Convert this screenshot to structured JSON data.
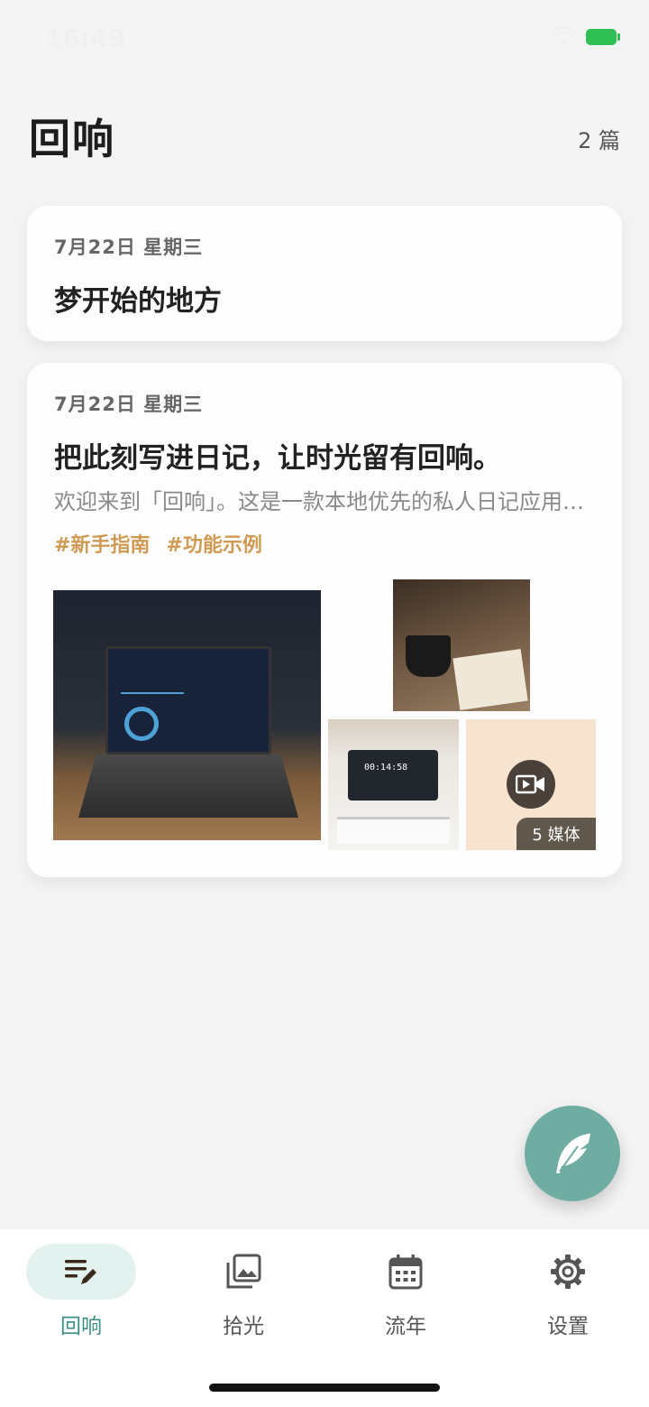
{
  "status_bar": {
    "time": "16:49"
  },
  "header": {
    "title": "回响",
    "count": "2 篇"
  },
  "entries": [
    {
      "date": "7月22日 星期三",
      "title": "梦开始的地方"
    },
    {
      "date": "7月22日 星期三",
      "title": "把此刻写进日记，让时光留有回响。",
      "excerpt": "欢迎来到「回响」。这是一款本地优先的私人日记应用…",
      "tags": [
        "#新手指南",
        "#功能示例"
      ],
      "media_badge": "5 媒体"
    }
  ],
  "tabbar": {
    "items": [
      {
        "label": "回响",
        "icon": "journal-edit-icon",
        "active": true
      },
      {
        "label": "拾光",
        "icon": "gallery-icon",
        "active": false
      },
      {
        "label": "流年",
        "icon": "calendar-icon",
        "active": false
      },
      {
        "label": "设置",
        "icon": "gear-icon",
        "active": false
      }
    ]
  },
  "colors": {
    "accent": "#3d8f86",
    "fab": "#6fada3",
    "tag": "#d09a52",
    "background": "#f4f4f4"
  }
}
